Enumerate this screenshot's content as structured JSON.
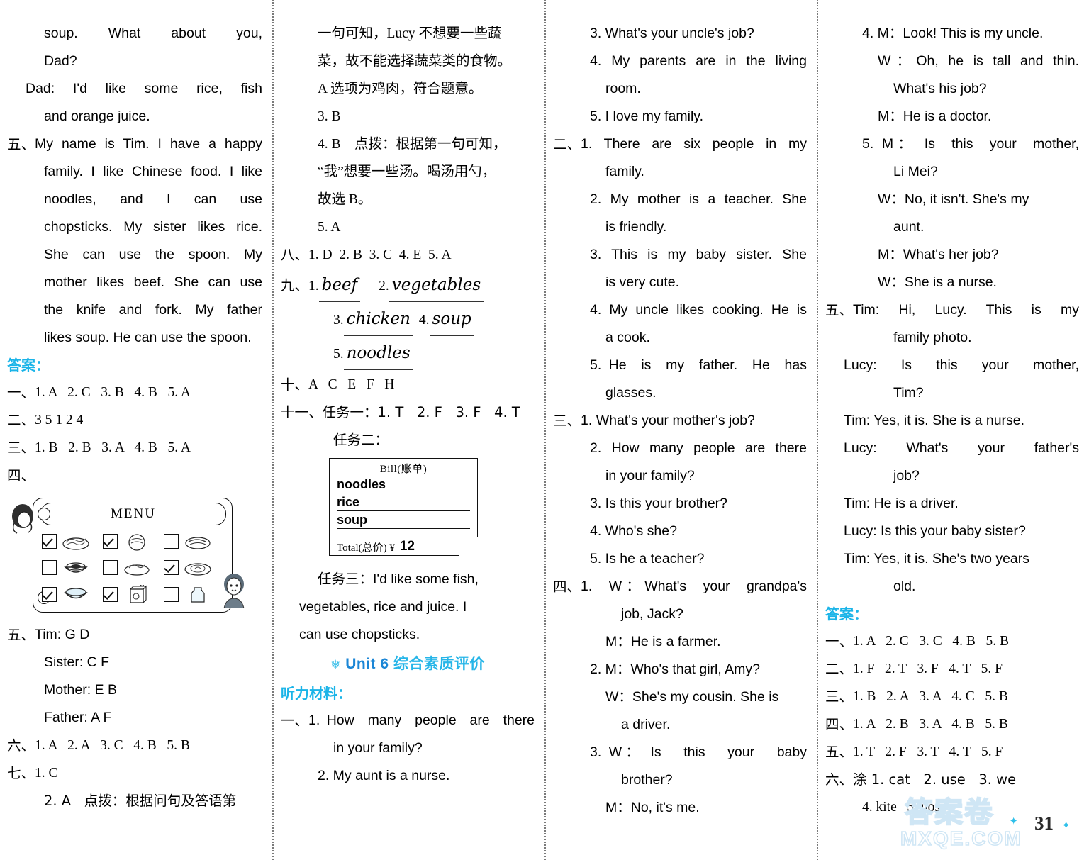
{
  "page": {
    "number": "31",
    "watermark_cn": "答案卷",
    "watermark_site": "MXQE.COM"
  },
  "col1": {
    "lines": [
      {
        "marker": "",
        "text": "soup.  What  about  you,"
      },
      {
        "marker": "",
        "text": "Dad?"
      },
      {
        "marker": "",
        "text": "Dad: I'd like some rice, fish"
      },
      {
        "marker": "",
        "text": "and orange juice."
      },
      {
        "marker": "五、",
        "text": "My name is Tim. I have a happy"
      },
      {
        "marker": "",
        "text": "family. I like Chinese food. I like"
      },
      {
        "marker": "",
        "text": "noodles,   and   I   can   use"
      },
      {
        "marker": "",
        "text": "chopsticks. My sister likes rice."
      },
      {
        "marker": "",
        "text": "She  can  use  the  spoon.  My"
      },
      {
        "marker": "",
        "text": "mother likes beef. She can use"
      },
      {
        "marker": "",
        "text": "the knife and fork. My father"
      },
      {
        "marker": "",
        "text": "likes soup. He can use the spoon."
      }
    ],
    "answers_label": "答案：",
    "answers": [
      {
        "marker": "一、",
        "text": "1. A   2. C   3. B   4. B   5. A"
      },
      {
        "marker": "二、",
        "text": "3 5 1 2 4"
      },
      {
        "marker": "三、",
        "text": "1. B   2. B   3. A   4. B   5. A"
      },
      {
        "marker": "四、",
        "text": ""
      }
    ],
    "menu": {
      "title": "MENU",
      "items": [
        {
          "name": "noodles-icon",
          "checked": true
        },
        {
          "name": "rice-icon",
          "checked": true
        },
        {
          "name": "fish-icon",
          "checked": false
        },
        {
          "name": "beef-bowl-icon",
          "checked": false
        },
        {
          "name": "vegetables-icon",
          "checked": false
        },
        {
          "name": "chicken-icon",
          "checked": true
        },
        {
          "name": "soup-bowl-icon",
          "checked": true
        },
        {
          "name": "juice-box-icon",
          "checked": true
        },
        {
          "name": "milk-bottle-icon",
          "checked": false
        }
      ]
    },
    "answers2": [
      {
        "marker": "五、",
        "text": "Tim: G D"
      },
      {
        "marker": "",
        "text": "Sister: C F"
      },
      {
        "marker": "",
        "text": "Mother: E B"
      },
      {
        "marker": "",
        "text": "Father: A F"
      },
      {
        "marker": "六、",
        "text": "1. A   2. A   3. C   4. B   5. B"
      },
      {
        "marker": "七、",
        "text": "1. C"
      },
      {
        "marker": "",
        "text": "2. A   点拨：根据问句及答语第"
      }
    ]
  },
  "col2": {
    "lines": [
      {
        "marker": "",
        "text": "一句可知，Lucy 不想要一些蔬"
      },
      {
        "marker": "",
        "text": "菜，故不能选择蔬菜类的食物。"
      },
      {
        "marker": "",
        "text": "A 选项为鸡肉，符合题意。"
      },
      {
        "marker": "",
        "text": "3. B"
      },
      {
        "marker": "",
        "text": "4. B　点拨：根据第一句可知，"
      },
      {
        "marker": "",
        "text": "“我”想要一些汤。喝汤用勺，"
      },
      {
        "marker": "",
        "text": "故选 B。"
      },
      {
        "marker": "",
        "text": "5. A"
      },
      {
        "marker": "八、",
        "text": "1. D  2. B  3. C  4. E  5. A"
      }
    ],
    "handwriting": {
      "marker": "九、",
      "items": [
        {
          "num": "1.",
          "word": "beef"
        },
        {
          "num": "2.",
          "word": "vegetables"
        },
        {
          "num": "3.",
          "word": "chicken"
        },
        {
          "num": "4.",
          "word": "soup"
        },
        {
          "num": "5.",
          "word": "noodles"
        }
      ]
    },
    "after_hw": [
      {
        "marker": "十、",
        "text": "A   C   E   F   H"
      },
      {
        "marker": "十一、",
        "text": "任务一：1. T   2. F   3. F   4. T"
      },
      {
        "marker": "",
        "text": "任务二："
      }
    ],
    "bill": {
      "title": "Bill(账单)",
      "items": [
        "noodles",
        "rice",
        "soup"
      ],
      "total_label": "Total(总价) ¥",
      "total_value": "12"
    },
    "task3": [
      {
        "marker": "",
        "text": "任务三：I'd like some fish,"
      },
      {
        "marker": "",
        "text": "vegetables, rice and juice. I"
      },
      {
        "marker": "",
        "text": "can use chopsticks."
      }
    ],
    "unit_title_en": "Unit 6",
    "unit_title_cn": "综合素质评价",
    "listening_label": "听力材料：",
    "listening": [
      {
        "marker": "一、",
        "text": "1. How  many  people  are  there"
      },
      {
        "marker": "",
        "text": "in your family?"
      },
      {
        "marker": "",
        "text": "2. My aunt is a nurse."
      }
    ]
  },
  "col3": {
    "lines": [
      {
        "marker": "",
        "text": "3. What's your uncle's job?"
      },
      {
        "marker": "",
        "text": "4. My parents are in the living"
      },
      {
        "marker": "",
        "text": "room."
      },
      {
        "marker": "",
        "text": "5. I love my family."
      },
      {
        "marker": "二、",
        "text": "1.  There  are  six  people  in  my"
      },
      {
        "marker": "",
        "text": "family."
      },
      {
        "marker": "",
        "text": "2. My mother is a teacher. She"
      },
      {
        "marker": "",
        "text": "is friendly."
      },
      {
        "marker": "",
        "text": "3. This is my baby sister. She"
      },
      {
        "marker": "",
        "text": "is very cute."
      },
      {
        "marker": "",
        "text": "4. My uncle likes cooking. He is"
      },
      {
        "marker": "",
        "text": "a cook."
      },
      {
        "marker": "",
        "text": "5. He  is  my  father.  He  has"
      },
      {
        "marker": "",
        "text": "glasses."
      },
      {
        "marker": "三、",
        "text": "1. What's your mother's job?"
      },
      {
        "marker": "",
        "text": "2.  How  many  people  are  there"
      },
      {
        "marker": "",
        "text": "in your family?"
      },
      {
        "marker": "",
        "text": "3. Is this your brother?"
      },
      {
        "marker": "",
        "text": "4. Who's she?"
      },
      {
        "marker": "",
        "text": "5. Is he a teacher?"
      },
      {
        "marker": "四、",
        "text": "1.  W：What's  your  grandpa's"
      },
      {
        "marker": "",
        "text": "job, Jack?"
      },
      {
        "marker": "",
        "text": "M：He is a farmer."
      },
      {
        "marker": "",
        "text": "2. M：Who's that girl, Amy?"
      },
      {
        "marker": "",
        "text": "W：She's my cousin. She is"
      },
      {
        "marker": "",
        "text": "a driver."
      },
      {
        "marker": "",
        "text": "3. W： Is   this   your   baby"
      },
      {
        "marker": "",
        "text": "brother?"
      },
      {
        "marker": "",
        "text": "M：No, it's me."
      }
    ]
  },
  "col4": {
    "lines": [
      {
        "marker": "",
        "text": "4. M：Look! This is my uncle."
      },
      {
        "marker": "",
        "text": "W：Oh, he is tall and thin."
      },
      {
        "marker": "",
        "text": "What's his job?"
      },
      {
        "marker": "",
        "text": "M：He is a doctor."
      },
      {
        "marker": "",
        "text": "5. M： Is  this  your  mother,"
      },
      {
        "marker": "",
        "text": "Li Mei?"
      },
      {
        "marker": "",
        "text": "W：No, it isn't. She's my"
      },
      {
        "marker": "",
        "text": "aunt."
      },
      {
        "marker": "",
        "text": "M：What's her job?"
      },
      {
        "marker": "",
        "text": "W：She is a nurse."
      },
      {
        "marker": "五、",
        "text": "Tim:  Hi,  Lucy.  This  is  my"
      },
      {
        "marker": "",
        "text": "family photo."
      },
      {
        "marker": "",
        "text": "Lucy:  Is  this  your  mother,"
      },
      {
        "marker": "",
        "text": "Tim?"
      },
      {
        "marker": "",
        "text": "Tim: Yes, it is. She is a nurse."
      },
      {
        "marker": "",
        "text": "Lucy:  What's  your  father's"
      },
      {
        "marker": "",
        "text": "job?"
      },
      {
        "marker": "",
        "text": "Tim: He is a driver."
      },
      {
        "marker": "",
        "text": "Lucy: Is this your baby sister?"
      },
      {
        "marker": "",
        "text": "Tim: Yes, it is. She's two years"
      },
      {
        "marker": "",
        "text": "old."
      }
    ],
    "answers_label": "答案：",
    "answers": [
      {
        "marker": "一、",
        "text": "1. A   2. C   3. C   4. B   5. B"
      },
      {
        "marker": "二、",
        "text": "1. F   2. T   3. F   4. T   5. F"
      },
      {
        "marker": "三、",
        "text": "1. B   2. A   3. A   4. C   5. B"
      },
      {
        "marker": "四、",
        "text": "1. A   2. B   3. A   4. B   5. B"
      },
      {
        "marker": "五、",
        "text": "1. T   2. F   3. T   4. T   5. F"
      },
      {
        "marker": "六、",
        "text": "涂 1. cat   2. use   3. we"
      },
      {
        "marker": "",
        "text": "4. kite   5. nose"
      }
    ]
  }
}
